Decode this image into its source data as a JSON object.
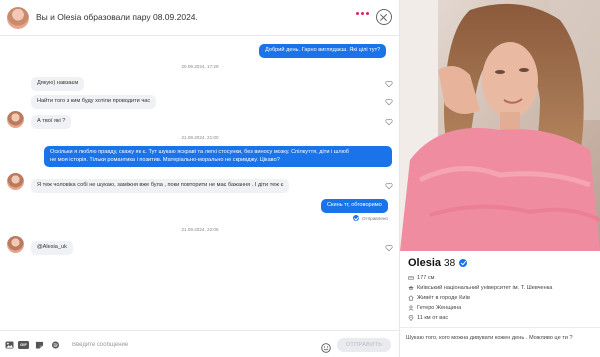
{
  "header": {
    "title": "Вы и Olesia образовали пару 08.09.2024."
  },
  "messages": {
    "sep1": "20.09.2024, 17:29",
    "m1": "Добрий день. Гарно виглядаєш. Які цілі тут?",
    "m2": "Дякую) навзаєм",
    "m3": "Найти того з ким буду хотіли проводити час",
    "m4": "А твої які ?",
    "sep2": "21.09.2024, 21:00",
    "m5_line1": "Оскільки я люблю правду, скажу як є. Тут шукаю яскраві та легкі стосунки, без виносу мозку. Спілкуття, діти і шлюб",
    "m5_line2": "не моя історія. Тільки романтика і позитив. Матеріально-морально не скривджу. Цікаво?",
    "m6": "Я теж чоловіка собі не шукаю, заміжня вже була , поки повторити не має бажання . І діти теж є",
    "m7": "Скинь тг, обговоримо",
    "status": "Отправлено",
    "sep3": "21.09.2024, 22:05",
    "m8": "@Alesia_uk"
  },
  "composer": {
    "placeholder": "Введите сообщение",
    "send_label": "ОТПРАВИТЬ",
    "gif_label": "GIF"
  },
  "profile": {
    "name": "Olesia",
    "age": "38",
    "height": "177 см",
    "education": "Київський національний університет ім. Т. Шевченка",
    "location": "Живёт в городе Київ",
    "orientation": "Гетеро Женщина",
    "distance": "11 км от вас",
    "bio": "Шукаю того, кого можна дивувати кожен день . Можливо це ти ?"
  },
  "colors": {
    "accent": "#1a73e8",
    "incoming_bubble": "#f0f1f4",
    "menu_dots": "#e0245e"
  }
}
